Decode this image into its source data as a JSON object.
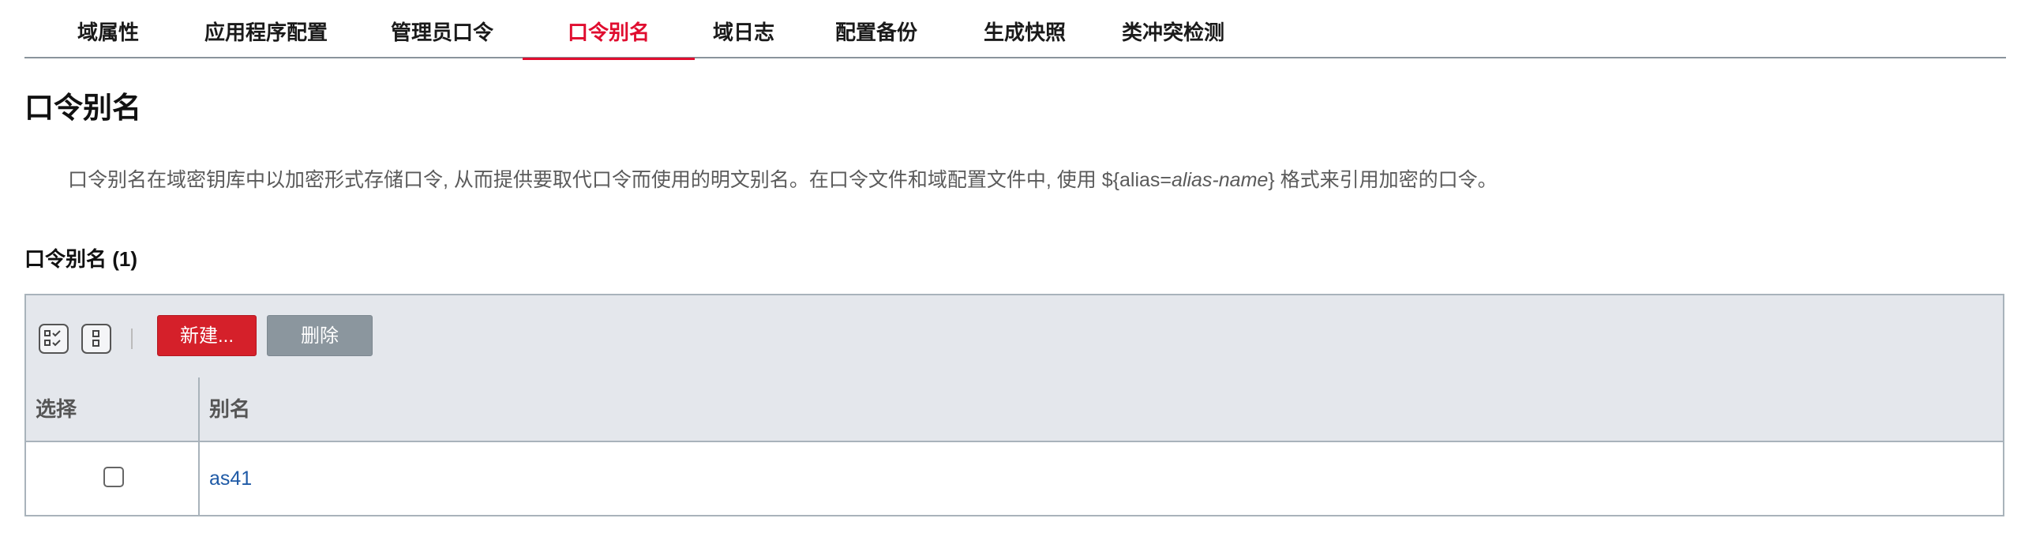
{
  "tabs": [
    {
      "label": "域属性"
    },
    {
      "label": "应用程序配置"
    },
    {
      "label": "管理员口令"
    },
    {
      "label": "口令别名",
      "active": true
    },
    {
      "label": "域日志"
    },
    {
      "label": "配置备份"
    },
    {
      "label": "生成快照"
    },
    {
      "label": "类冲突检测"
    }
  ],
  "page": {
    "title": "口令别名",
    "description_prefix": "口令别名在域密钥库中以加密形式存储口令, 从而提供要取代口令而使用的明文别名。在口令文件和域配置文件中, 使用 ${alias=",
    "description_italic": "alias-name",
    "description_suffix": "} 格式来引用加密的口令。"
  },
  "section": {
    "title": "口令别名 (1)"
  },
  "toolbar": {
    "icons": [
      "select-all-icon",
      "deselect-all-icon"
    ],
    "new_label": "新建...",
    "delete_label": "删除"
  },
  "table": {
    "columns": [
      "选择",
      "别名"
    ],
    "rows": [
      {
        "selected": false,
        "alias": "as41"
      }
    ]
  },
  "colors": {
    "accent": "#e00d2f",
    "new_button": "#d5202a",
    "delete_button": "#8b969e",
    "header_bg": "#e4e7ec",
    "link": "#1f5aa6"
  }
}
